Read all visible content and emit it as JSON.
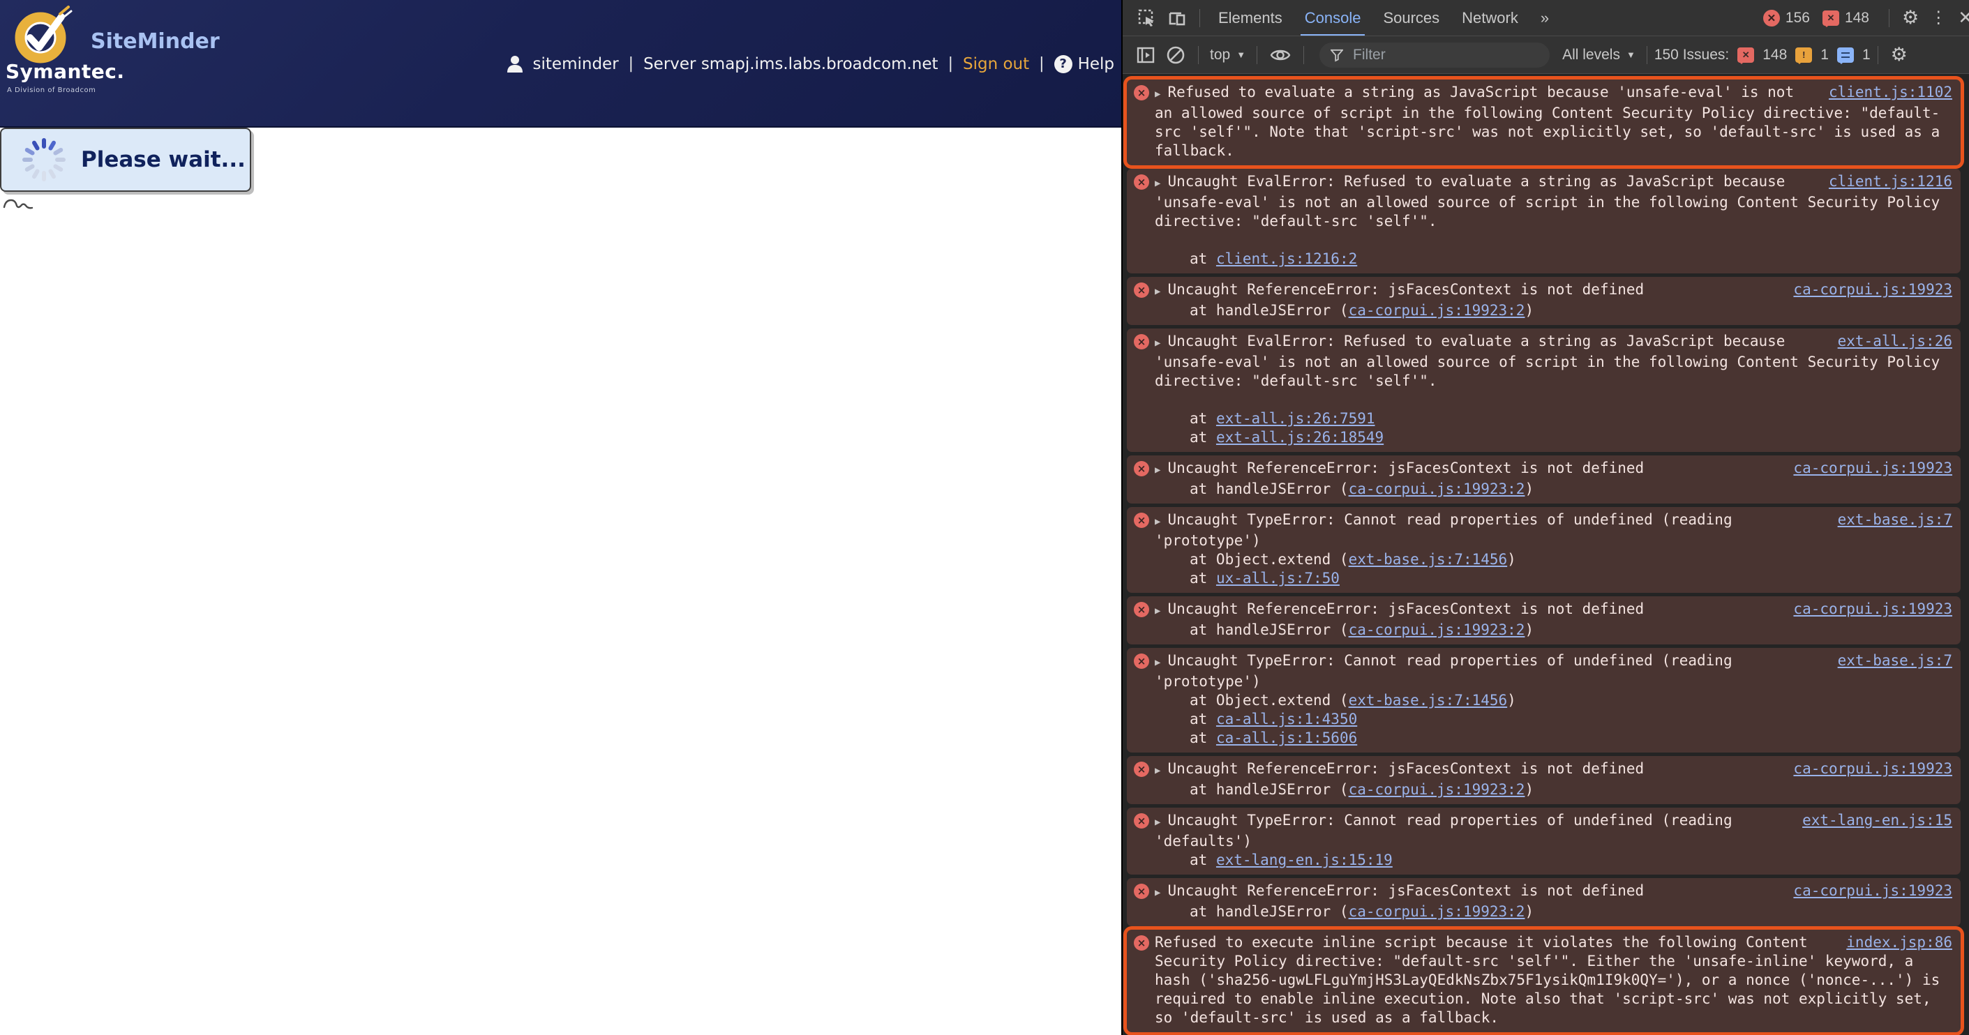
{
  "page": {
    "brand": {
      "wordmark": "Symantec.",
      "tagline": "A Division of Broadcom",
      "product": "SiteMinder"
    },
    "header": {
      "user": "siteminder",
      "sep": "|",
      "server": "Server smapj.ims.labs.broadcom.net",
      "sign_out": "Sign out",
      "help": "Help"
    },
    "loading_text": "Please wait..."
  },
  "devtools": {
    "tabs": [
      {
        "label": "Elements",
        "active": false
      },
      {
        "label": "Console",
        "active": true
      },
      {
        "label": "Sources",
        "active": false
      },
      {
        "label": "Network",
        "active": false
      },
      {
        "label": "»",
        "active": false
      }
    ],
    "header_counts": {
      "errors": "156",
      "messages": "148"
    },
    "toolbar": {
      "context": "top",
      "filter_placeholder": "Filter",
      "levels_label": "All levels",
      "issues_label": "150 Issues:",
      "issues": [
        {
          "count": "148",
          "type": "error"
        },
        {
          "count": "1",
          "type": "warning"
        },
        {
          "count": "1",
          "type": "info"
        }
      ]
    },
    "console_messages": [
      {
        "highlighted": true,
        "expandable": true,
        "text": "Refused to evaluate a string as JavaScript because 'unsafe-eval' is not an allowed source of script in the following Content Security Policy directive: \"default-src 'self'\". Note that 'script-src' was not explicitly set, so 'default-src' is used as a fallback.",
        "link": "client.js:1102",
        "stack": [],
        "stack_gap": false
      },
      {
        "highlighted": false,
        "expandable": true,
        "text": "Uncaught EvalError: Refused to evaluate a string as JavaScript because 'unsafe-eval' is not an allowed source of script in the following Content Security Policy directive: \"default-src 'self'\".",
        "link": "client.js:1216",
        "stack": [
          {
            "prefix": "at ",
            "link": "client.js:1216:2",
            "suffix": ""
          }
        ],
        "stack_gap": true
      },
      {
        "highlighted": false,
        "expandable": true,
        "text": "Uncaught ReferenceError: jsFacesContext is not defined",
        "link": "ca-corpui.js:19923",
        "stack": [
          {
            "prefix": "at handleJSError (",
            "link": "ca-corpui.js:19923:2",
            "suffix": ")"
          }
        ],
        "stack_gap": false
      },
      {
        "highlighted": false,
        "expandable": true,
        "text": "Uncaught EvalError: Refused to evaluate a string as JavaScript because 'unsafe-eval' is not an allowed source of script in the following Content Security Policy directive: \"default-src 'self'\".",
        "link": "ext-all.js:26",
        "stack": [
          {
            "prefix": "at ",
            "link": "ext-all.js:26:7591",
            "suffix": ""
          },
          {
            "prefix": "at ",
            "link": "ext-all.js:26:18549",
            "suffix": ""
          }
        ],
        "stack_gap": true
      },
      {
        "highlighted": false,
        "expandable": true,
        "text": "Uncaught ReferenceError: jsFacesContext is not defined",
        "link": "ca-corpui.js:19923",
        "stack": [
          {
            "prefix": "at handleJSError (",
            "link": "ca-corpui.js:19923:2",
            "suffix": ")"
          }
        ],
        "stack_gap": false
      },
      {
        "highlighted": false,
        "expandable": true,
        "text": "Uncaught TypeError: Cannot read properties of undefined (reading 'prototype')",
        "link": "ext-base.js:7",
        "stack": [
          {
            "prefix": "at Object.extend (",
            "link": "ext-base.js:7:1456",
            "suffix": ")"
          },
          {
            "prefix": "at ",
            "link": "ux-all.js:7:50",
            "suffix": ""
          }
        ],
        "stack_gap": false
      },
      {
        "highlighted": false,
        "expandable": true,
        "text": "Uncaught ReferenceError: jsFacesContext is not defined",
        "link": "ca-corpui.js:19923",
        "stack": [
          {
            "prefix": "at handleJSError (",
            "link": "ca-corpui.js:19923:2",
            "suffix": ")"
          }
        ],
        "stack_gap": false
      },
      {
        "highlighted": false,
        "expandable": true,
        "text": "Uncaught TypeError: Cannot read properties of undefined (reading 'prototype')",
        "link": "ext-base.js:7",
        "stack": [
          {
            "prefix": "at Object.extend (",
            "link": "ext-base.js:7:1456",
            "suffix": ")"
          },
          {
            "prefix": "at ",
            "link": "ca-all.js:1:4350",
            "suffix": ""
          },
          {
            "prefix": "at ",
            "link": "ca-all.js:1:5606",
            "suffix": ""
          }
        ],
        "stack_gap": false
      },
      {
        "highlighted": false,
        "expandable": true,
        "text": "Uncaught ReferenceError: jsFacesContext is not defined",
        "link": "ca-corpui.js:19923",
        "stack": [
          {
            "prefix": "at handleJSError (",
            "link": "ca-corpui.js:19923:2",
            "suffix": ")"
          }
        ],
        "stack_gap": false
      },
      {
        "highlighted": false,
        "expandable": true,
        "text": "Uncaught TypeError: Cannot read properties of undefined (reading 'defaults')",
        "link": "ext-lang-en.js:15",
        "stack": [
          {
            "prefix": "at ",
            "link": "ext-lang-en.js:15:19",
            "suffix": ""
          }
        ],
        "stack_gap": false
      },
      {
        "highlighted": false,
        "expandable": true,
        "text": "Uncaught ReferenceError: jsFacesContext is not defined",
        "link": "ca-corpui.js:19923",
        "stack": [
          {
            "prefix": "at handleJSError (",
            "link": "ca-corpui.js:19923:2",
            "suffix": ")"
          }
        ],
        "stack_gap": false
      },
      {
        "highlighted": true,
        "expandable": false,
        "text": "Refused to execute inline script because it violates the following Content Security Policy directive: \"default-src 'self'\". Either the 'unsafe-inline' keyword, a hash ('sha256-ugwLFLguYmjHS3LayQEdkNsZbx75F1ysikQm1I9k0QY='), or a nonce ('nonce-...') is required to enable inline execution. Note also that 'script-src' was not explicitly set, so 'default-src' is used as a fallback.",
        "link": "index.jsp:86",
        "stack": [],
        "stack_gap": false
      }
    ]
  },
  "colors": {
    "header_navy": "#1a2252",
    "brand_gold": "#e8b13c",
    "product_blue": "#a9c2f2",
    "sign_out_gold": "#e7a63b",
    "wait_box_bg": "#dce9f8",
    "devtools_toolbar": "#333333",
    "console_bg": "#242424",
    "error_row_bg": "#493431",
    "error_icon": "#e46962",
    "link_blue": "#9ab3ea",
    "active_tab_blue": "#8ab4f8",
    "highlight_outline": "#e8531d",
    "warning_orange": "#e8a23c"
  }
}
